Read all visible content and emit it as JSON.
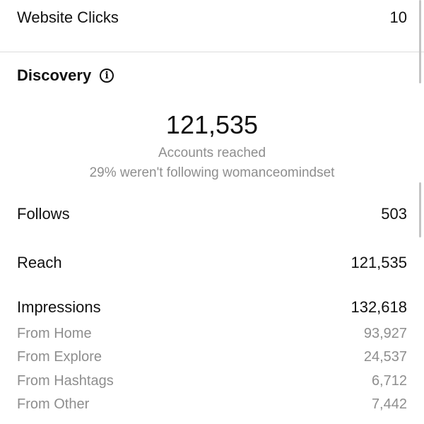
{
  "website_clicks": {
    "label": "Website Clicks",
    "value": "10"
  },
  "discovery": {
    "title": "Discovery",
    "info_icon": "info-icon",
    "accounts_reached_value": "121,535",
    "accounts_reached_label": "Accounts reached",
    "non_followers_note": "29% weren't following womanceomindset"
  },
  "metrics": {
    "follows": {
      "label": "Follows",
      "value": "503"
    },
    "reach": {
      "label": "Reach",
      "value": "121,535"
    },
    "impressions": {
      "label": "Impressions",
      "value": "132,618",
      "sources": [
        {
          "label": "From Home",
          "value": "93,927"
        },
        {
          "label": "From Explore",
          "value": "24,537"
        },
        {
          "label": "From Hashtags",
          "value": "6,712"
        },
        {
          "label": "From Other",
          "value": "7,442"
        }
      ]
    }
  },
  "colors": {
    "primary_text": "#111111",
    "secondary_text": "#8e8e8e",
    "divider": "#dcdcdc",
    "background": "#ffffff"
  }
}
